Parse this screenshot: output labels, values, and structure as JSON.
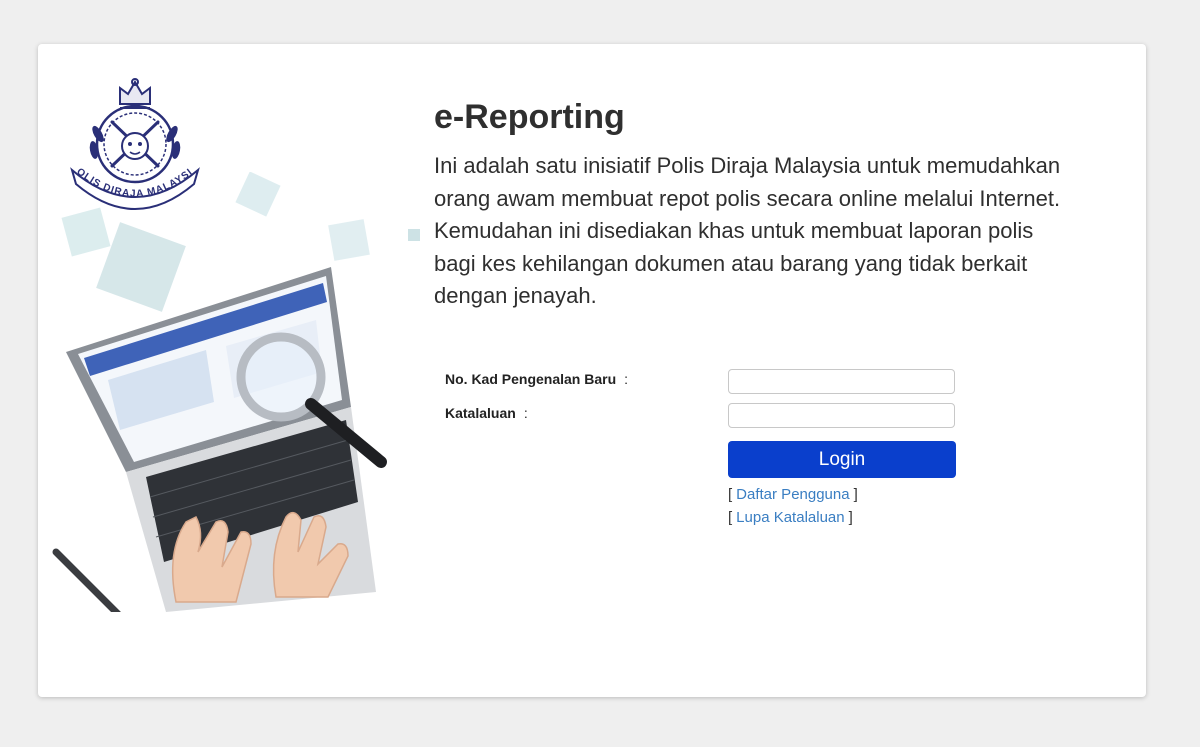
{
  "header": {
    "title": "e-Reporting",
    "description": [
      "Ini adalah satu inisiatif Polis Diraja Malaysia untuk memudahkan orang awam membuat repot polis secara online melalui Internet.",
      "Kemudahan ini disediakan khas untuk membuat laporan polis bagi kes kehilangan dokumen atau barang yang tidak berkait dengan jenayah."
    ]
  },
  "logo": {
    "text": "POLIS DIRAJA MALAYSIA"
  },
  "form": {
    "ic_label": "No. Kad Pengenalan Baru",
    "password_label": "Katalaluan",
    "separator": ":",
    "ic_value": "",
    "password_value": "",
    "login_label": "Login"
  },
  "links": {
    "open_bracket": "[",
    "close_bracket": "]",
    "register_label": "Daftar Pengguna",
    "forgot_label": "Lupa Katalaluan"
  },
  "colors": {
    "accent": "#0a3fcc",
    "link": "#3a7ec2",
    "logo": "#2a2f78"
  },
  "icons": {
    "logo": "pdrm-crest-icon",
    "illustration": "laptop-magnifier-illustration"
  }
}
